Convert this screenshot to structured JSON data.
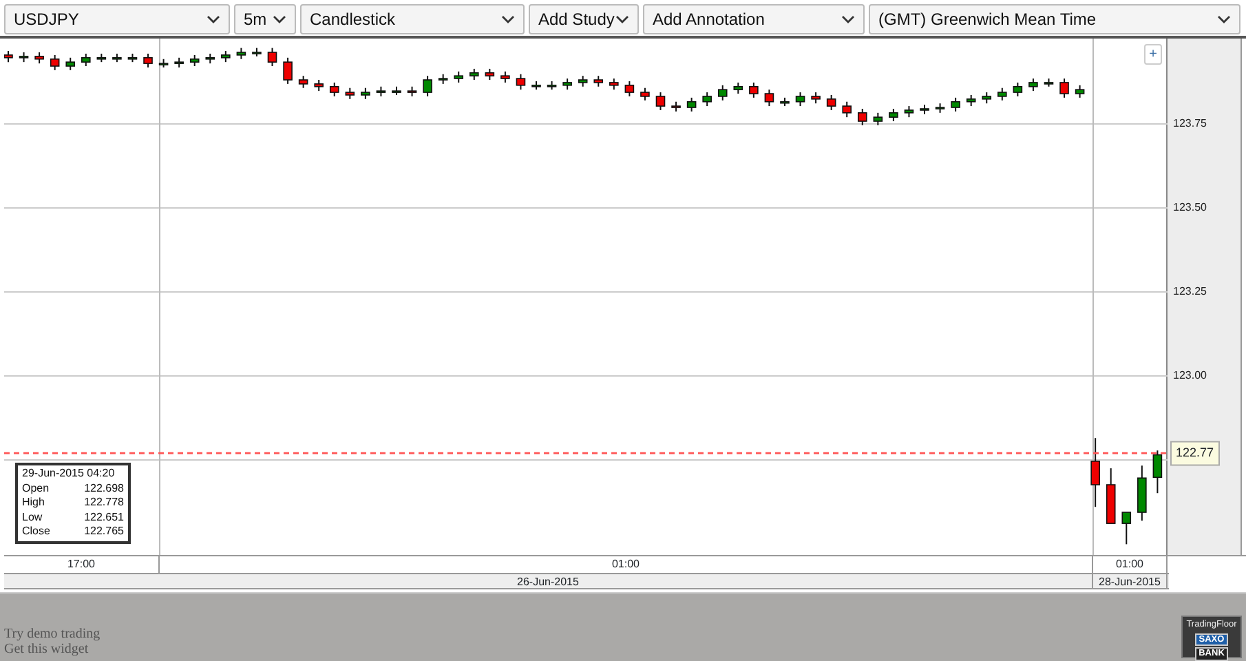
{
  "toolbar": [
    {
      "label": "USDJPY"
    },
    {
      "label": "5m"
    },
    {
      "label": "Candlestick"
    },
    {
      "label": "Add Study"
    },
    {
      "label": "Add Annotation"
    },
    {
      "label": "(GMT) Greenwich Mean Time"
    }
  ],
  "zoom_button": "+",
  "chart_data": {
    "type": "candlestick",
    "ylim": [
      122.467,
      124.004
    ],
    "yticks": [
      {
        "value": 123.75,
        "label": "123.75"
      },
      {
        "value": 123.5,
        "label": "123.50"
      },
      {
        "value": 123.25,
        "label": "123.25"
      },
      {
        "value": 123.0,
        "label": "123.00"
      }
    ],
    "grid": true,
    "ref_lines": [
      {
        "axis": "y",
        "value": 122.77,
        "label": "122.77",
        "color": "#ff5555"
      }
    ],
    "categories": [
      null,
      null,
      null,
      null,
      null,
      null,
      null,
      null,
      null,
      null,
      null,
      null,
      null,
      null,
      null,
      null,
      null,
      null,
      null,
      null,
      null,
      null,
      null,
      null,
      null,
      null,
      null,
      null,
      null,
      null,
      null,
      null,
      null,
      null,
      null,
      null,
      null,
      null,
      null,
      null,
      null,
      null,
      null,
      null,
      null,
      null,
      null,
      null,
      null,
      null,
      null,
      null,
      null,
      null,
      null,
      null,
      null,
      null,
      null,
      null,
      null,
      null,
      null,
      null,
      null,
      null,
      null,
      null,
      null,
      null,
      null,
      null,
      null,
      null,
      null
    ],
    "ohlc": [
      [
        123.955,
        123.967,
        123.934,
        123.947
      ],
      [
        123.947,
        123.963,
        123.934,
        123.951
      ],
      [
        123.951,
        123.963,
        123.93,
        123.943
      ],
      [
        123.943,
        123.955,
        123.91,
        123.922
      ],
      [
        123.922,
        123.947,
        123.91,
        123.934
      ],
      [
        123.934,
        123.959,
        123.922,
        123.947
      ],
      [
        123.947,
        123.959,
        123.934,
        123.947
      ],
      [
        123.947,
        123.959,
        123.934,
        123.947
      ],
      [
        123.947,
        123.959,
        123.934,
        123.947
      ],
      [
        123.947,
        123.959,
        123.918,
        123.93
      ],
      [
        123.93,
        123.943,
        123.918,
        123.93
      ],
      [
        123.93,
        123.947,
        123.918,
        123.934
      ],
      [
        123.934,
        123.955,
        123.922,
        123.943
      ],
      [
        123.943,
        123.959,
        123.93,
        123.947
      ],
      [
        123.947,
        123.967,
        123.934,
        123.955
      ],
      [
        123.955,
        123.976,
        123.943,
        123.963
      ],
      [
        123.963,
        123.976,
        123.951,
        123.963
      ],
      [
        123.963,
        123.976,
        123.922,
        123.934
      ],
      [
        123.934,
        123.947,
        123.869,
        123.881
      ],
      [
        123.881,
        123.893,
        123.857,
        123.869
      ],
      [
        123.869,
        123.881,
        123.848,
        123.861
      ],
      [
        123.861,
        123.873,
        123.832,
        123.844
      ],
      [
        123.844,
        123.857,
        123.824,
        123.836
      ],
      [
        123.836,
        123.857,
        123.824,
        123.844
      ],
      [
        123.844,
        123.861,
        123.832,
        123.848
      ],
      [
        123.848,
        123.861,
        123.836,
        123.848
      ],
      [
        123.848,
        123.861,
        123.832,
        123.844
      ],
      [
        123.844,
        123.893,
        123.832,
        123.881
      ],
      [
        123.881,
        123.898,
        123.869,
        123.885
      ],
      [
        123.885,
        123.906,
        123.873,
        123.893
      ],
      [
        123.893,
        123.914,
        123.881,
        123.902
      ],
      [
        123.902,
        123.914,
        123.881,
        123.893
      ],
      [
        123.893,
        123.906,
        123.873,
        123.885
      ],
      [
        123.885,
        123.898,
        123.852,
        123.865
      ],
      [
        123.865,
        123.877,
        123.852,
        123.865
      ],
      [
        123.865,
        123.877,
        123.852,
        123.865
      ],
      [
        123.865,
        123.885,
        123.852,
        123.873
      ],
      [
        123.873,
        123.893,
        123.861,
        123.881
      ],
      [
        123.881,
        123.893,
        123.861,
        123.873
      ],
      [
        123.873,
        123.885,
        123.852,
        123.865
      ],
      [
        123.865,
        123.877,
        123.832,
        123.844
      ],
      [
        123.844,
        123.857,
        123.82,
        123.832
      ],
      [
        123.832,
        123.844,
        123.791,
        123.803
      ],
      [
        123.803,
        123.816,
        123.787,
        123.799
      ],
      [
        123.799,
        123.828,
        123.787,
        123.816
      ],
      [
        123.816,
        123.844,
        123.803,
        123.832
      ],
      [
        123.832,
        123.865,
        123.82,
        123.852
      ],
      [
        123.852,
        123.873,
        123.84,
        123.861
      ],
      [
        123.861,
        123.873,
        123.828,
        123.84
      ],
      [
        123.84,
        123.852,
        123.803,
        123.816
      ],
      [
        123.816,
        123.828,
        123.803,
        123.816
      ],
      [
        123.816,
        123.844,
        123.803,
        123.832
      ],
      [
        123.832,
        123.844,
        123.811,
        123.824
      ],
      [
        123.824,
        123.836,
        123.791,
        123.803
      ],
      [
        123.803,
        123.816,
        123.77,
        123.783
      ],
      [
        123.783,
        123.795,
        123.746,
        123.758
      ],
      [
        123.758,
        123.783,
        123.746,
        123.77
      ],
      [
        123.77,
        123.795,
        123.758,
        123.783
      ],
      [
        123.783,
        123.803,
        123.77,
        123.791
      ],
      [
        123.791,
        123.807,
        123.779,
        123.795
      ],
      [
        123.795,
        123.811,
        123.783,
        123.799
      ],
      [
        123.799,
        123.828,
        123.787,
        123.816
      ],
      [
        123.816,
        123.836,
        123.803,
        123.824
      ],
      [
        123.824,
        123.844,
        123.811,
        123.832
      ],
      [
        123.832,
        123.857,
        123.82,
        123.844
      ],
      [
        123.844,
        123.873,
        123.832,
        123.861
      ],
      [
        123.861,
        123.885,
        123.848,
        123.873
      ],
      [
        123.873,
        123.885,
        123.861,
        123.873
      ],
      [
        123.873,
        123.885,
        123.828,
        123.84
      ],
      [
        123.84,
        123.865,
        123.828,
        123.852
      ],
      [
        122.746,
        122.815,
        122.61,
        122.676
      ],
      [
        122.676,
        122.725,
        122.561,
        122.561
      ],
      [
        122.561,
        122.594,
        122.499,
        122.594
      ],
      [
        122.594,
        122.733,
        122.569,
        122.696
      ],
      [
        122.698,
        122.778,
        122.651,
        122.765
      ]
    ]
  },
  "tooltip": {
    "title": "29-Jun-2015 04:20",
    "rows": [
      {
        "label": "Open",
        "value": "122.698"
      },
      {
        "label": "High",
        "value": "122.778"
      },
      {
        "label": "Low",
        "value": "122.651"
      },
      {
        "label": "Close",
        "value": "122.765"
      }
    ]
  },
  "time_axis": [
    "17:00",
    "01:00",
    "01:00"
  ],
  "date_axis": [
    "26-Jun-2015",
    "28-Jun-2015"
  ],
  "footer": {
    "links": [
      "Try demo trading",
      "Get this widget"
    ],
    "logo": {
      "title": "TradingFloor",
      "lines": [
        "SAXO",
        "BANK"
      ]
    }
  }
}
